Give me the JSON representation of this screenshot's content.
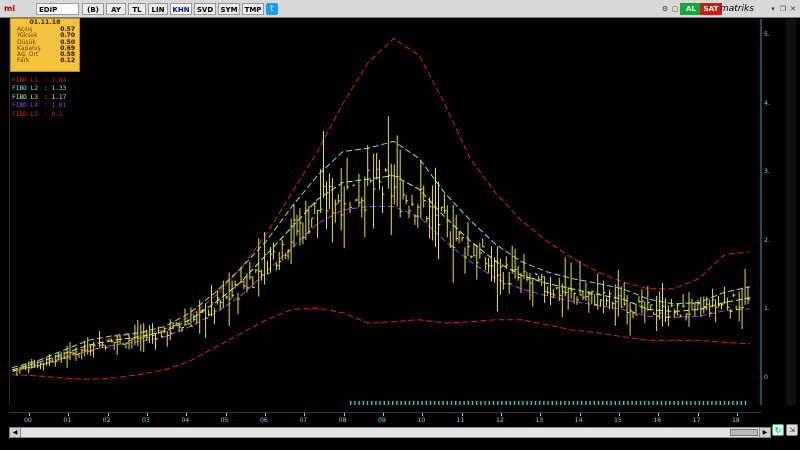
{
  "toolbar": {
    "logo": "mi",
    "symbol": "EDIP",
    "buttons": [
      {
        "id": "period-b",
        "label": "(B)"
      },
      {
        "id": "ay",
        "label": "AY"
      },
      {
        "id": "tl",
        "label": "TL"
      },
      {
        "id": "lin",
        "label": "LIN"
      },
      {
        "id": "khn",
        "label": "KHN",
        "active": true
      },
      {
        "id": "svd",
        "label": "SVD"
      },
      {
        "id": "sym",
        "label": "SYM"
      },
      {
        "id": "tmp",
        "label": "TMP"
      }
    ],
    "buy_label": "AL",
    "sell_label": "SAT",
    "brand": "matriks",
    "buy_color": "#12a83a",
    "sell_color": "#d01818"
  },
  "info": {
    "date": "01.11.18",
    "rows": [
      {
        "label": "Açılış",
        "value": "0.57"
      },
      {
        "label": "Yüksek",
        "value": "0.70"
      },
      {
        "label": "Düşük",
        "value": "0.50"
      },
      {
        "label": "Kapanış",
        "value": "0.69"
      },
      {
        "label": "Ağ. Ort",
        "value": "0.58"
      },
      {
        "label": "Fark",
        "value": "0.12"
      }
    ]
  },
  "legend": [
    {
      "name": "FIBD L1",
      "value": ": 1.84",
      "color": "#e02020"
    },
    {
      "name": "FIBD L2",
      "value": ": 1.33",
      "color": "#7fe0e0"
    },
    {
      "name": "FIBD L3",
      "value": ": 1.17",
      "color": "#b0ff90"
    },
    {
      "name": "FIBD L4",
      "value": ": 1.01",
      "color": "#9a40ff"
    },
    {
      "name": "FIBD L5",
      "value": ": 0.5",
      "color": "#e02020"
    }
  ],
  "chart_data": {
    "type": "line",
    "x_labels": [
      "00",
      "01",
      "02",
      "03",
      "04",
      "05",
      "06",
      "07",
      "08",
      "09",
      "10",
      "11",
      "12",
      "13",
      "14",
      "15",
      "16",
      "17",
      "18"
    ],
    "y_ticks": [
      "5.",
      "4.",
      "3.",
      "2.",
      "1.",
      "0"
    ],
    "ylim": [
      0,
      5
    ],
    "series": [
      {
        "name": "FIBD L1",
        "color": "#e02020",
        "dash": true,
        "values": [
          0.1,
          0.18,
          0.3,
          0.45,
          0.6,
          0.65,
          0.7,
          0.9,
          1.2,
          1.6,
          2.1,
          2.7,
          3.3,
          4.0,
          4.6,
          4.95,
          4.7,
          4.0,
          3.2,
          2.7,
          2.3,
          2.0,
          1.75,
          1.55,
          1.4,
          1.3,
          1.3,
          1.45,
          1.8,
          1.84
        ]
      },
      {
        "name": "FIBD L2",
        "color": "#7fe0e0",
        "dash": true,
        "values": [
          0.15,
          0.25,
          0.4,
          0.55,
          0.62,
          0.66,
          0.75,
          0.95,
          1.25,
          1.6,
          2.0,
          2.5,
          2.95,
          3.3,
          3.35,
          3.45,
          3.2,
          2.7,
          2.3,
          1.95,
          1.7,
          1.55,
          1.45,
          1.38,
          1.3,
          1.15,
          1.08,
          1.1,
          1.25,
          1.33
        ]
      },
      {
        "name": "FIBD L3",
        "color": "#b0ff90",
        "dash": true,
        "values": [
          0.12,
          0.22,
          0.35,
          0.48,
          0.55,
          0.6,
          0.68,
          0.85,
          1.1,
          1.4,
          1.8,
          2.2,
          2.6,
          2.85,
          2.9,
          2.95,
          2.75,
          2.35,
          2.0,
          1.7,
          1.5,
          1.38,
          1.3,
          1.22,
          1.15,
          1.0,
          0.97,
          1.0,
          1.1,
          1.17
        ]
      },
      {
        "name": "FIBD L4",
        "color": "#9a40ff",
        "dash": true,
        "values": [
          0.1,
          0.18,
          0.28,
          0.4,
          0.48,
          0.53,
          0.6,
          0.75,
          0.95,
          1.2,
          1.55,
          1.9,
          2.25,
          2.45,
          2.5,
          2.5,
          2.35,
          2.0,
          1.7,
          1.45,
          1.3,
          1.2,
          1.12,
          1.06,
          1.0,
          0.9,
          0.88,
          0.9,
          0.98,
          1.01
        ]
      },
      {
        "name": "FIBD L5",
        "color": "#e02020",
        "dash": true,
        "values": [
          0.05,
          0.03,
          0.0,
          -0.02,
          0.0,
          0.05,
          0.12,
          0.25,
          0.45,
          0.65,
          0.85,
          1.0,
          1.02,
          0.95,
          0.8,
          0.82,
          0.85,
          0.8,
          0.82,
          0.85,
          0.85,
          0.78,
          0.7,
          0.66,
          0.6,
          0.55,
          0.55,
          0.55,
          0.52,
          0.5
        ]
      }
    ]
  }
}
